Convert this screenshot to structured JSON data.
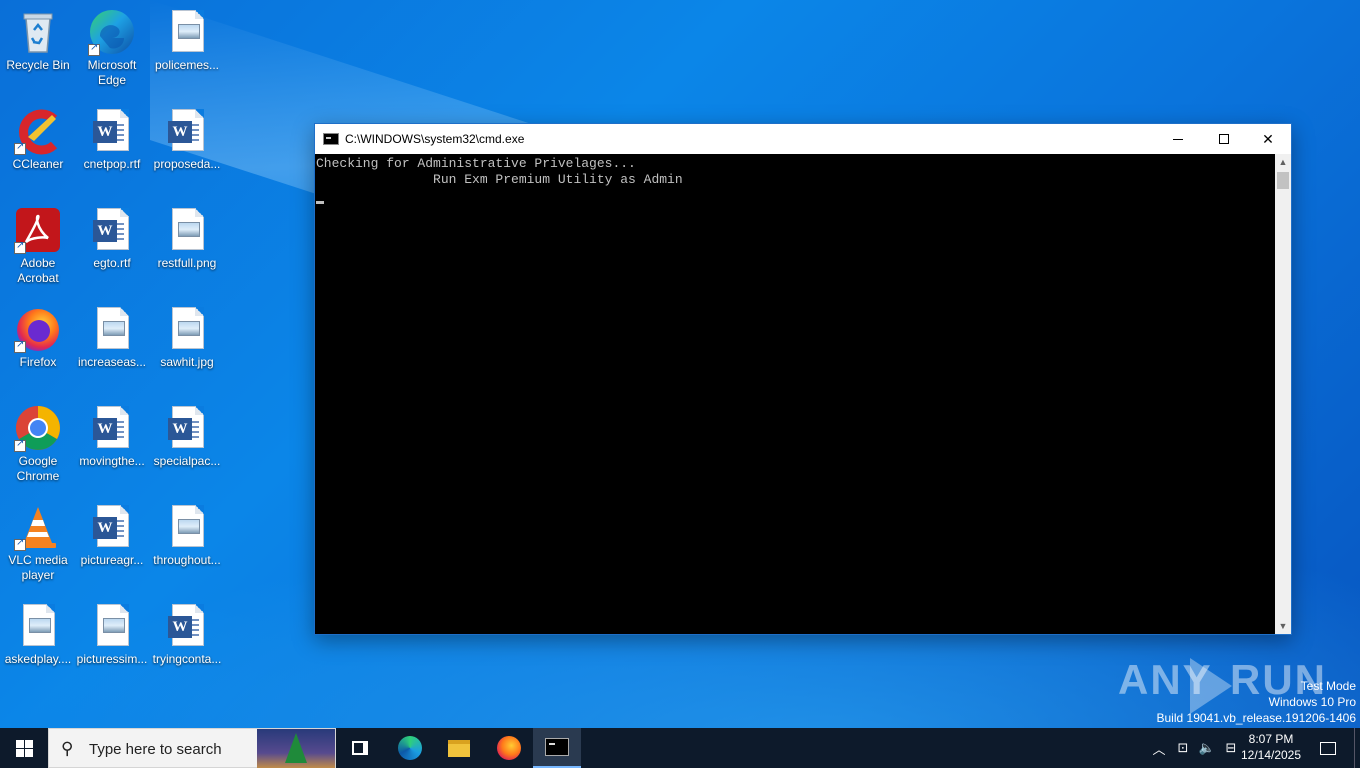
{
  "desktop": {
    "icons": [
      {
        "label": "Recycle Bin",
        "kind": "recycle-bin"
      },
      {
        "label": "Microsoft Edge",
        "kind": "edge"
      },
      {
        "label": "policemes...",
        "kind": "image-file"
      },
      {
        "label": "CCleaner",
        "kind": "ccleaner"
      },
      {
        "label": "cnetpop.rtf",
        "kind": "word-file"
      },
      {
        "label": "proposeda...",
        "kind": "word-file"
      },
      {
        "label": "Adobe Acrobat",
        "kind": "acrobat"
      },
      {
        "label": "egto.rtf",
        "kind": "word-file"
      },
      {
        "label": "restfull.png",
        "kind": "image-file"
      },
      {
        "label": "Firefox",
        "kind": "firefox"
      },
      {
        "label": "increaseas...",
        "kind": "image-file"
      },
      {
        "label": "sawhit.jpg",
        "kind": "image-file"
      },
      {
        "label": "Google Chrome",
        "kind": "chrome"
      },
      {
        "label": "movingthe...",
        "kind": "word-file"
      },
      {
        "label": "specialpac...",
        "kind": "word-file"
      },
      {
        "label": "VLC media player",
        "kind": "vlc"
      },
      {
        "label": "pictureagr...",
        "kind": "word-file"
      },
      {
        "label": "throughout...",
        "kind": "image-file"
      },
      {
        "label": "askedplay....",
        "kind": "image-file"
      },
      {
        "label": "picturessim...",
        "kind": "image-file"
      },
      {
        "label": "tryingconta...",
        "kind": "word-file"
      }
    ]
  },
  "cmd_window": {
    "title": "C:\\WINDOWS\\system32\\cmd.exe",
    "lines": [
      "Checking for Administrative Privelages...",
      "               Run Exm Premium Utility as Admin"
    ],
    "minimize_icon": "minimize-icon",
    "maximize_icon": "maximize-icon",
    "close_icon": "close-icon"
  },
  "watermark": {
    "text_left": "ANY",
    "text_right": "RUN"
  },
  "system_info": {
    "line1": "Test Mode",
    "line2": "Windows 10 Pro",
    "line3": "Build 19041.vb_release.191206-1406"
  },
  "taskbar": {
    "search_placeholder": "Type here to search",
    "pinned": [
      "task-view",
      "edge",
      "file-explorer",
      "firefox",
      "cmd"
    ],
    "time": "8:07 PM",
    "date": "12/14/2025"
  },
  "colors": {
    "desktop": "#0b86e8",
    "taskbar": "#0d1a2b",
    "console_bg": "#000000",
    "console_text": "#c0c0c0"
  }
}
